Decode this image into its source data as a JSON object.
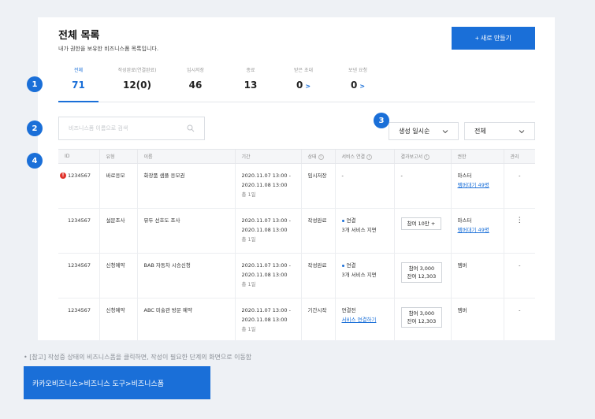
{
  "header": {
    "title": "전체 목록",
    "subtitle": "내가 권한을 보유한 비즈니스폼 목록입니다.",
    "new_button": "+ 새로 만들기"
  },
  "tabs": [
    {
      "label": "전체",
      "count": "71",
      "active": true,
      "arrow": ""
    },
    {
      "label": "작성완료(연결완료)",
      "count": "12(0)",
      "active": false,
      "arrow": ""
    },
    {
      "label": "임시저장",
      "count": "46",
      "active": false,
      "arrow": ""
    },
    {
      "label": "종료",
      "count": "13",
      "active": false,
      "arrow": ""
    },
    {
      "label": "받은 초대",
      "count": "0",
      "active": false,
      "arrow": ">"
    },
    {
      "label": "보낸 요청",
      "count": "0",
      "active": false,
      "arrow": ">"
    }
  ],
  "search": {
    "placeholder": "비즈니스폼 이름으로 검색"
  },
  "filters": {
    "sort": "생성 일시순",
    "type": "전체"
  },
  "table": {
    "columns": [
      "ID",
      "유형",
      "이름",
      "기간",
      "상태",
      "서비스 연결",
      "결과보고서",
      "권한",
      "관리"
    ],
    "rows": [
      {
        "id": "1234567",
        "warning": "!",
        "type": "바로응모",
        "name": "화장품 샘플 응모권",
        "period_start": "2020.11.07 13:00 -",
        "period_end": "2020.11.08 13:00",
        "duration": "총 1일",
        "status": "임시저장",
        "service_main": "-",
        "service_sub": "",
        "report": "-",
        "report2": "",
        "role": "마스터",
        "role_link": "멤버대기 49명",
        "action": "-"
      },
      {
        "id": "1234567",
        "warning": "",
        "type": "설문조사",
        "name": "뮤두 선호도 조사",
        "period_start": "2020.11.07 13:00 -",
        "period_end": "2020.11.08 13:00",
        "duration": "총 1일",
        "status": "작성완료",
        "service_main": "연결",
        "service_sub": "3개 서비스 지면",
        "report": "참여 10만 +",
        "report2": "",
        "role": "마스터",
        "role_link": "멤버대기 49명",
        "action": "⋮"
      },
      {
        "id": "1234567",
        "warning": "",
        "type": "신청예약",
        "name": "BAB 자동차 시승신청",
        "period_start": "2020.11.07 13:00 -",
        "period_end": "2020.11.08 13:00",
        "duration": "총 1일",
        "status": "작성완료",
        "service_main": "연결",
        "service_sub": "3개 서비스 지면",
        "report": "참여 3,000",
        "report2": "잔여 12,303",
        "role": "멤버",
        "role_link": "",
        "action": "-"
      },
      {
        "id": "1234567",
        "warning": "",
        "type": "신청예약",
        "name": "ABC 미술관 방문 예약",
        "period_start": "2020.11.07 13:00 -",
        "period_end": "2020.11.08 13:00",
        "duration": "총 1일",
        "status": "기간시작",
        "service_main": "연결전",
        "service_sub": "서비스 연결하기",
        "report": "참여 3,000",
        "report2": "잔여 12,303",
        "role": "멤버",
        "role_link": "",
        "action": "-"
      }
    ]
  },
  "markers": [
    "1",
    "2",
    "3",
    "4"
  ],
  "note": "• [참고] 작성중 상태의 비즈니스폼을 클릭하면, 작성이 필요한 단계의 화면으로 이동함",
  "breadcrumb": "카카오비즈니스>비즈니스 도구>비즈니스폼",
  "colors": {
    "accent": "#1a6fd8",
    "warning": "#e0332b",
    "background": "#eef1f5"
  }
}
